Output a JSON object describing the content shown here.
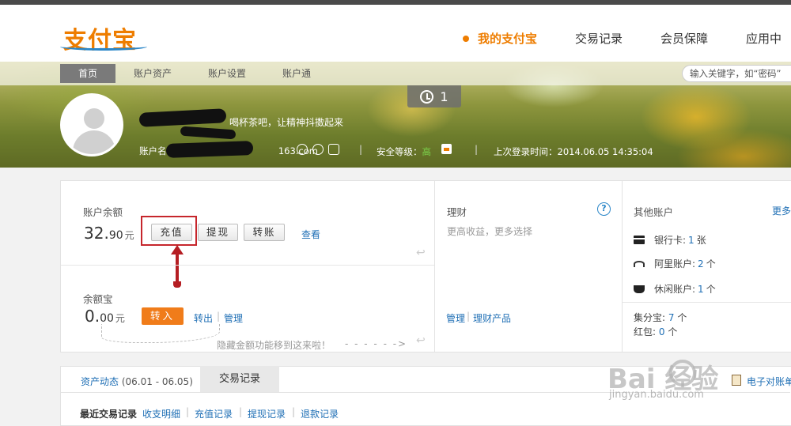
{
  "logo": {
    "text": "支付宝"
  },
  "main_nav": [
    {
      "label": "我的支付宝",
      "active": true
    },
    {
      "label": "交易记录",
      "active": false
    },
    {
      "label": "会员保障",
      "active": false
    },
    {
      "label": "应用中",
      "active": false
    }
  ],
  "sub_nav": [
    {
      "label": "首页",
      "active": true
    },
    {
      "label": "账户资产",
      "active": false
    },
    {
      "label": "账户设置",
      "active": false
    },
    {
      "label": "账户通",
      "active": false
    }
  ],
  "search": {
    "placeholder": "输入关键字，如“密码”"
  },
  "alarm": {
    "count": "1"
  },
  "profile": {
    "greeting": "喝杯茶吧，让精神抖擞起来",
    "account_label": "账户名",
    "email_suffix": "163.com",
    "security_label": "安全等级：",
    "security_level": "高",
    "last_login_label": "上次登录时间：",
    "last_login": "2014.06.05 14:35:04"
  },
  "balance": {
    "title": "账户余额",
    "int": "32.",
    "dec": "90",
    "unit": "元",
    "recharge": "充值",
    "withdraw": "提现",
    "transfer": "转账",
    "view": "查看"
  },
  "yuebao": {
    "title": "余额宝",
    "int": "0.",
    "dec": "00",
    "unit": "元",
    "transfer_in": "转入",
    "transfer_out": "转出",
    "manage": "管理",
    "hint": "隐藏金额功能移到这来啦！"
  },
  "licai": {
    "title": "理财",
    "subtitle": "更高收益，更多选择",
    "manage": "管理",
    "products": "理财产品",
    "help": "?"
  },
  "other_accounts": {
    "title": "其他账户",
    "more": "更多",
    "bank_label": "银行卡:",
    "bank_count": "1",
    "bank_unit": "张",
    "ali_label": "阿里账户:",
    "ali_count": "2",
    "ali_unit": "个",
    "leisure_label": "休闲账户:",
    "leisure_count": "1",
    "leisure_unit": "个",
    "jifen_label": "集分宝:",
    "jifen_count": "7",
    "jifen_unit": "个",
    "hongbao_label": "红包:",
    "hongbao_count": "0",
    "hongbao_unit": "个"
  },
  "assets": {
    "tab_dynamic": "资产动态",
    "range": "(06.01 - 06.05)",
    "tab_records": "交易记录",
    "bill": "电子对账单",
    "recent_label": "最近交易记录",
    "links": [
      "收支明细",
      "充值记录",
      "提现记录",
      "退款记录"
    ]
  },
  "watermark": {
    "text": "Bai  经验",
    "url": "jingyan.baidu.com"
  }
}
